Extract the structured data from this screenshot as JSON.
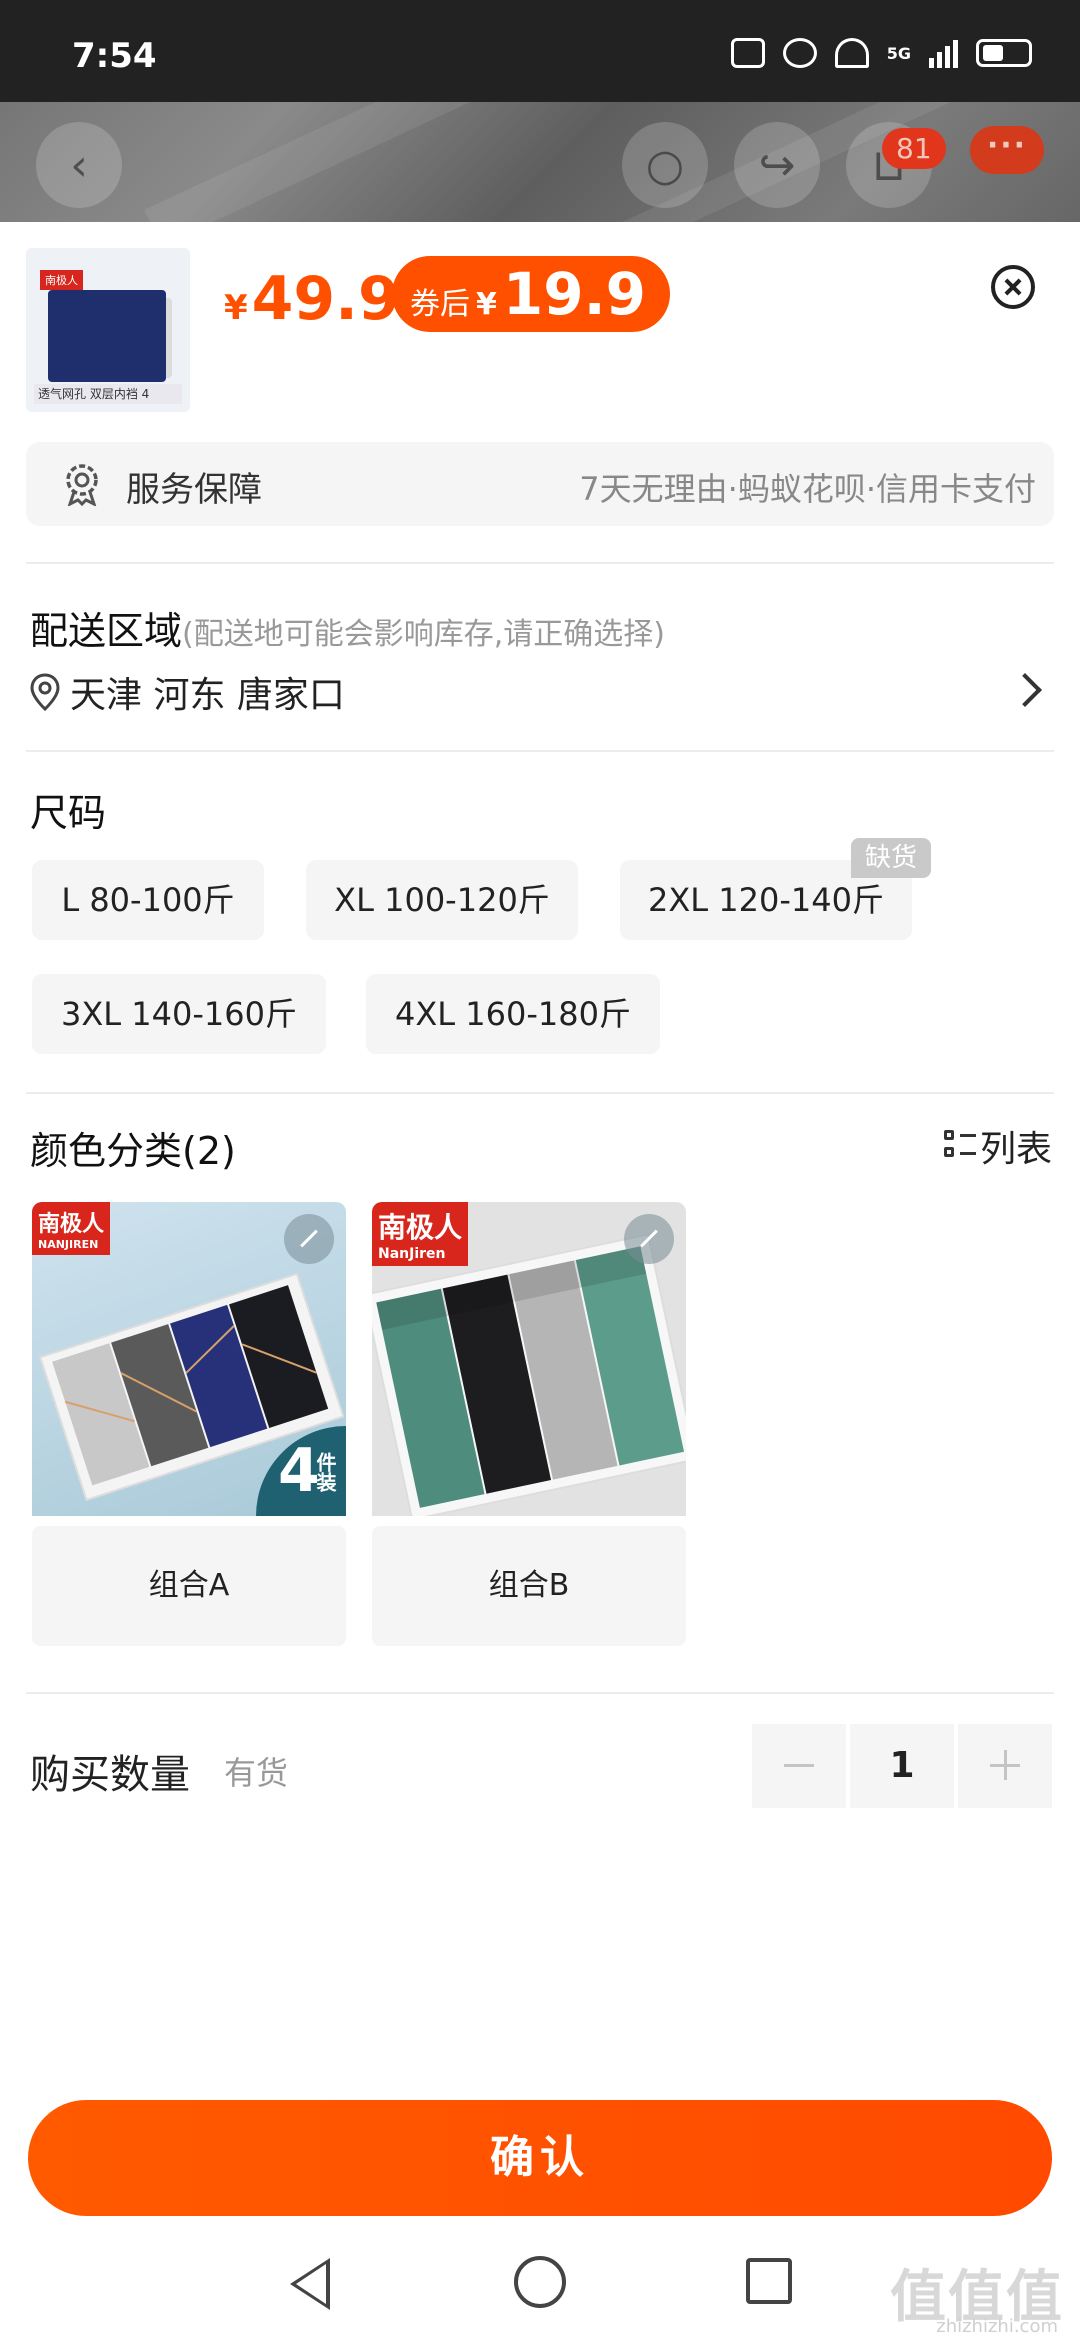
{
  "status_bar": {
    "time": "7:54",
    "network": "5G"
  },
  "background_nav": {
    "cart_count": "81",
    "more_label": "···"
  },
  "product": {
    "currency": "¥",
    "price": "49.9",
    "coupon_label": "券后",
    "coupon_price": "19.9",
    "thumb_brand": "南极人",
    "thumb_caption": "透气网孔 双层内裆 4"
  },
  "service": {
    "title": "服务保障",
    "detail": "7天无理由·蚂蚁花呗·信用卡支付"
  },
  "delivery": {
    "title": "配送区域",
    "subtitle": "(配送地可能会影响库存,请正确选择)",
    "address": "天津 河东 唐家口"
  },
  "size": {
    "title": "尺码",
    "options": [
      {
        "label": "L 80-100斤",
        "sold_out": false
      },
      {
        "label": "XL 100-120斤",
        "sold_out": false
      },
      {
        "label": "2XL 120-140斤",
        "sold_out": true
      },
      {
        "label": "3XL 140-160斤",
        "sold_out": false
      },
      {
        "label": "4XL 160-180斤",
        "sold_out": false
      }
    ],
    "sold_out_tag": "缺货"
  },
  "color": {
    "title": "颜色分类(2)",
    "list_toggle": "列表",
    "options": [
      {
        "label": "组合A",
        "brand": "南极人",
        "brand_sub": "NANJIREN",
        "pack_count": "4",
        "pack_unit": "件装"
      },
      {
        "label": "组合B",
        "brand": "南极人",
        "brand_sub": "NanJiren"
      }
    ]
  },
  "quantity": {
    "title": "购买数量",
    "stock": "有货",
    "value": "1"
  },
  "confirm_label": "确认",
  "watermark": {
    "main": "值值值",
    "sub": "zhizhizhi.com"
  }
}
